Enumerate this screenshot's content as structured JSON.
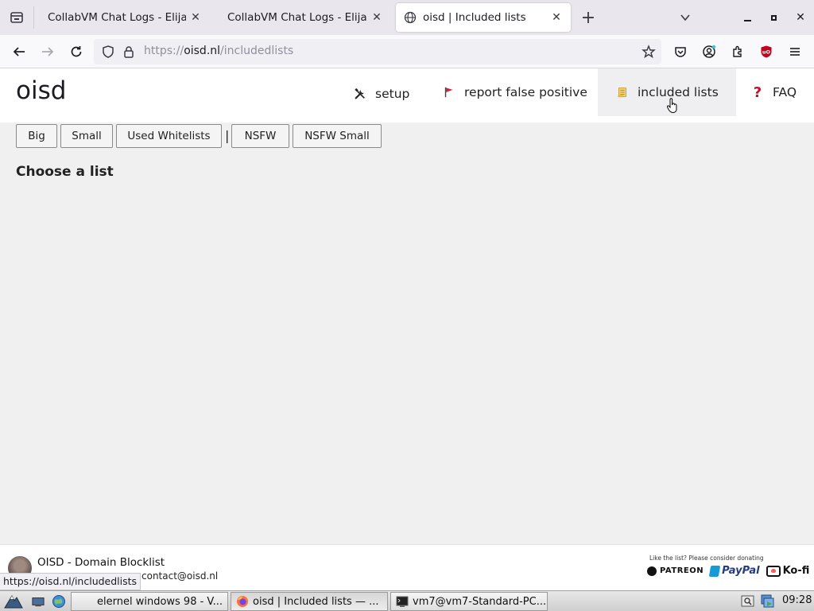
{
  "browser": {
    "tabs": [
      {
        "title": "CollabVM Chat Logs - Elijahr's",
        "active": false
      },
      {
        "title": "CollabVM Chat Logs - Elijahr's",
        "active": false
      },
      {
        "title": "oisd | Included lists",
        "active": true
      }
    ],
    "url": {
      "scheme": "https://",
      "host": "oisd.nl",
      "path": "/includedlists"
    },
    "status_url": "https://oisd.nl/includedlists"
  },
  "site": {
    "logo": "oisd",
    "nav": [
      {
        "label": "setup",
        "icon": "tools-icon"
      },
      {
        "label": "report false positive",
        "icon": "flag-icon"
      },
      {
        "label": "included lists",
        "icon": "scroll-icon",
        "active": true
      },
      {
        "label": "FAQ",
        "icon": "question-icon"
      }
    ],
    "list_buttons": [
      "Big",
      "Small",
      "Used Whitelists",
      "NSFW",
      "NSFW Small"
    ],
    "separator": "|",
    "heading": "Choose a list",
    "footer": {
      "title": "OISD - Domain Blocklist",
      "email": "contact@oisd.nl",
      "donate_text": "Like the list? Please consider donating",
      "donate": [
        "PATREON",
        "PayPal",
        "Ko-fi"
      ]
    }
  },
  "taskbar": {
    "tasks": [
      {
        "label": "elernel windows 98 - V...",
        "icon": "none"
      },
      {
        "label": "oisd | Included lists — ...",
        "icon": "firefox-icon",
        "active": true
      },
      {
        "label": "vm7@vm7-Standard-PC...",
        "icon": "terminal-icon"
      }
    ],
    "clock": "09:28"
  },
  "colors": {
    "flag": "#d0263d",
    "question": "#c8102e",
    "scroll": "#e8b93a",
    "ublock": "#c4001f"
  }
}
